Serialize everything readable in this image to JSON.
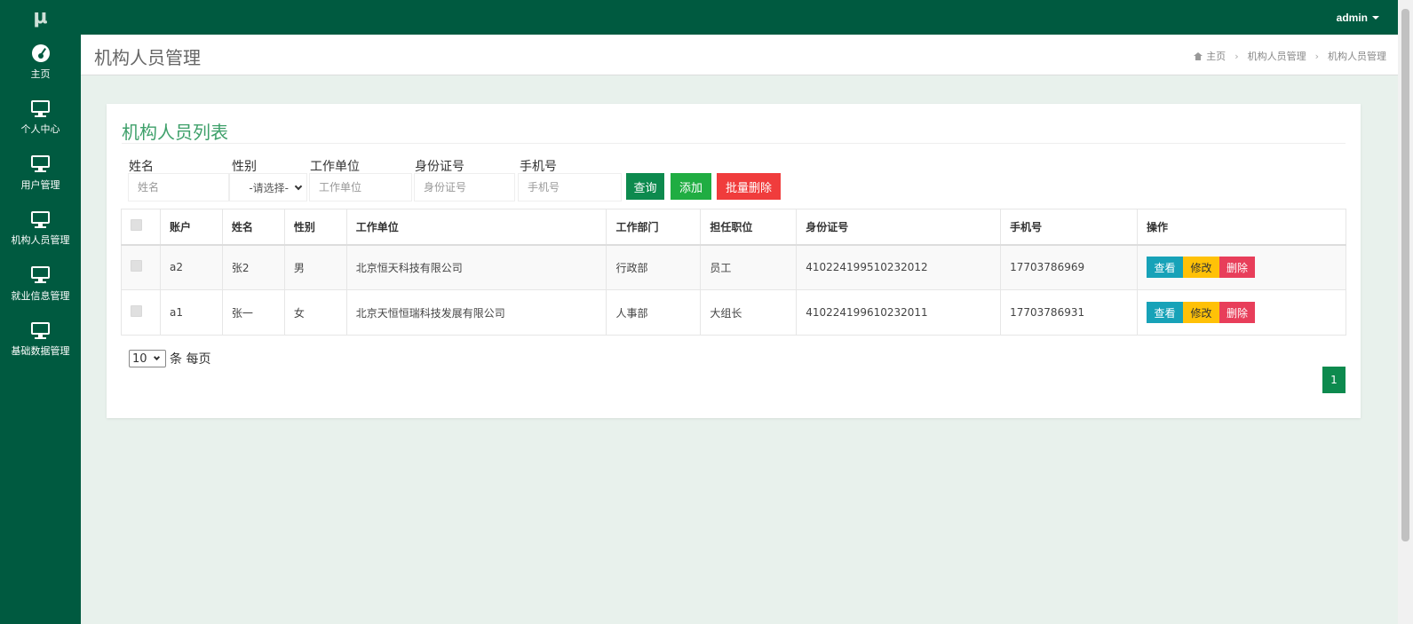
{
  "app": {
    "logo": "μ"
  },
  "topbar": {
    "user": "admin"
  },
  "sidebar": {
    "items": [
      {
        "label": "主页",
        "icon": "dashboard-icon"
      },
      {
        "label": "个人中心",
        "icon": "monitor-icon"
      },
      {
        "label": "用户管理",
        "icon": "monitor-icon"
      },
      {
        "label": "机构人员管理",
        "icon": "monitor-icon"
      },
      {
        "label": "就业信息管理",
        "icon": "monitor-icon"
      },
      {
        "label": "基础数据管理",
        "icon": "monitor-icon"
      }
    ]
  },
  "header": {
    "title": "机构人员管理",
    "breadcrumb": [
      "主页",
      "机构人员管理",
      "机构人员管理"
    ]
  },
  "panel": {
    "title": "机构人员列表"
  },
  "filters": {
    "name": {
      "label": "姓名",
      "placeholder": "姓名"
    },
    "gender": {
      "label": "性别",
      "value": "-请选择-"
    },
    "company": {
      "label": "工作单位",
      "placeholder": "工作单位"
    },
    "idcard": {
      "label": "身份证号",
      "placeholder": "身份证号"
    },
    "phone": {
      "label": "手机号",
      "placeholder": "手机号"
    }
  },
  "buttons": {
    "query": "查询",
    "add": "添加",
    "batch_delete": "批量删除"
  },
  "table": {
    "headers": [
      "账户",
      "姓名",
      "性别",
      "工作单位",
      "工作部门",
      "担任职位",
      "身份证号",
      "手机号",
      "操作"
    ],
    "rows": [
      {
        "account": "a2",
        "name": "张2",
        "gender": "男",
        "company": "北京恒天科技有限公司",
        "department": "行政部",
        "position": "员工",
        "idcard": "410224199510232012",
        "phone": "17703786969"
      },
      {
        "account": "a1",
        "name": "张一",
        "gender": "女",
        "company": "北京天恒恒瑞科技发展有限公司",
        "department": "人事部",
        "position": "大组长",
        "idcard": "410224199610232011",
        "phone": "17703786931"
      }
    ],
    "actions": {
      "view": "查看",
      "edit": "修改",
      "delete": "删除"
    }
  },
  "pagination": {
    "page_size": "10",
    "page_size_suffix": "条 每页",
    "current_page": "1"
  }
}
